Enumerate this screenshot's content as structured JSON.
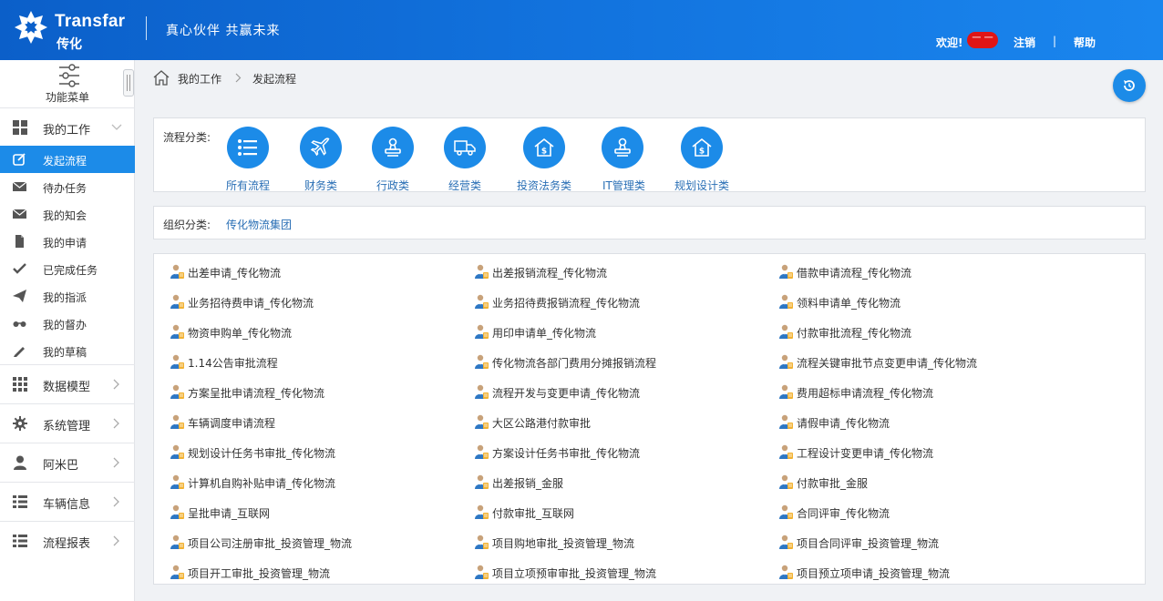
{
  "header": {
    "brand_name": "Transfar",
    "brand_sub": "传化",
    "slogan": "真心伙伴  共赢未来",
    "welcome": "欢迎!",
    "user_badge": "一 一",
    "logout": "注销",
    "separator": "|",
    "help": "帮助"
  },
  "sidebar": {
    "menu_toggle_label": "功能菜单",
    "my_work": "我的工作",
    "items": [
      {
        "label": "发起流程",
        "icon": "edit-icon",
        "active": true
      },
      {
        "label": "待办任务",
        "icon": "envelope-icon"
      },
      {
        "label": "我的知会",
        "icon": "envelope-icon"
      },
      {
        "label": "我的申请",
        "icon": "document-icon"
      },
      {
        "label": "已完成任务",
        "icon": "check-icon"
      },
      {
        "label": "我的指派",
        "icon": "send-icon"
      },
      {
        "label": "我的督办",
        "icon": "glasses-icon"
      },
      {
        "label": "我的草稿",
        "icon": "pencil-icon"
      }
    ],
    "groups": [
      {
        "label": "数据模型",
        "icon": "grid-icon"
      },
      {
        "label": "系统管理",
        "icon": "gear-icon"
      },
      {
        "label": "阿米巴",
        "icon": "user-icon"
      },
      {
        "label": "车辆信息",
        "icon": "list-icon"
      },
      {
        "label": "流程报表",
        "icon": "list-icon"
      }
    ]
  },
  "breadcrumb": {
    "level1": "我的工作",
    "separator": ">",
    "level2": "发起流程"
  },
  "categories": {
    "label": "流程分类:",
    "items": [
      {
        "label": "所有流程",
        "icon": "list-icon"
      },
      {
        "label": "财务类",
        "icon": "airplane-icon"
      },
      {
        "label": "行政类",
        "icon": "stamp-icon"
      },
      {
        "label": "经营类",
        "icon": "truck-icon"
      },
      {
        "label": "投资法务类",
        "icon": "house-dollar-icon"
      },
      {
        "label": "IT管理类",
        "icon": "stamp-icon"
      },
      {
        "label": "规划设计类",
        "icon": "house-dollar-icon"
      }
    ]
  },
  "org": {
    "label": "组织分类:",
    "value": "传化物流集团"
  },
  "processes": [
    [
      "出差申请_传化物流",
      "出差报销流程_传化物流",
      "借款申请流程_传化物流"
    ],
    [
      "业务招待费申请_传化物流",
      "业务招待费报销流程_传化物流",
      "领料申请单_传化物流"
    ],
    [
      "物资申购单_传化物流",
      "用印申请单_传化物流",
      "付款审批流程_传化物流"
    ],
    [
      "1.14公告审批流程",
      "传化物流各部门费用分摊报销流程",
      "流程关键审批节点变更申请_传化物流"
    ],
    [
      "方案呈批申请流程_传化物流",
      "流程开发与变更申请_传化物流",
      "费用超标申请流程_传化物流"
    ],
    [
      "车辆调度申请流程",
      "大区公路港付款审批",
      "请假申请_传化物流"
    ],
    [
      "规划设计任务书审批_传化物流",
      "方案设计任务书审批_传化物流",
      "工程设计变更申请_传化物流"
    ],
    [
      "计算机自购补贴申请_传化物流",
      "出差报销_金服",
      "付款审批_金服"
    ],
    [
      "呈批申请_互联网",
      "付款审批_互联网",
      "合同评审_传化物流"
    ],
    [
      "项目公司注册审批_投资管理_物流",
      "项目购地审批_投资管理_物流",
      "项目合同评审_投资管理_物流"
    ],
    [
      "项目开工审批_投资管理_物流",
      "项目立项预审审批_投资管理_物流",
      "项目预立项申请_投资管理_物流"
    ]
  ],
  "colors": {
    "header_start": "#0b5fc9",
    "header_end": "#1a86ee",
    "accent": "#1c8be8",
    "link": "#2a6fb5",
    "badge": "#e01515"
  }
}
